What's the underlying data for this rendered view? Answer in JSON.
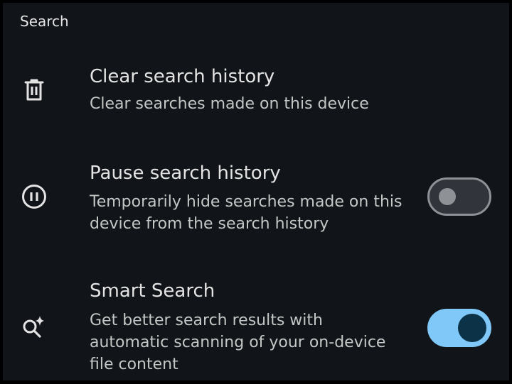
{
  "section": {
    "header": "Search"
  },
  "items": [
    {
      "icon": "trash-icon",
      "title": "Clear search history",
      "subtitle": "Clear searches made on this device"
    },
    {
      "icon": "pause-circle-icon",
      "title": "Pause search history",
      "subtitle": "Temporarily hide searches made on this device from the search history",
      "toggle": "off"
    },
    {
      "icon": "smart-search-icon",
      "title": "Smart Search",
      "subtitle": "Get better search results with automatic scanning of your on-device file content",
      "toggle": "on"
    }
  ],
  "colors": {
    "background": "#111418",
    "text_primary": "#e3e3e3",
    "text_secondary": "#c4c7c5",
    "toggle_on_track": "#7fc8f8",
    "toggle_on_knob": "#0b3246",
    "toggle_off_outline": "#8e9196"
  }
}
